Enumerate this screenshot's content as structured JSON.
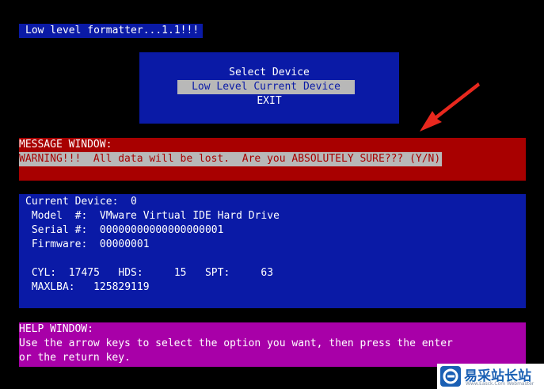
{
  "title": "Low level formatter...1.1!!!",
  "menu": {
    "items": [
      {
        "label": "Select Device"
      },
      {
        "label": "Low Level Current Device",
        "selected": true
      },
      {
        "label": "EXIT"
      }
    ]
  },
  "message_window": {
    "header": "MESSAGE WINDOW:",
    "text": "WARNING!!!  All data will be lost.  Are you ABSOLUTELY SURE??? (Y/N)"
  },
  "device_window": {
    "current_device": "Current Device:  0",
    "model": " Model  #:  VMware Virtual IDE Hard Drive",
    "serial": " Serial #:  00000000000000000001",
    "firmware": " Firmware:  00000001",
    "geometry": " CYL:  17475   HDS:     15   SPT:     63",
    "maxlba": " MAXLBA:   125829119"
  },
  "help_window": {
    "header": "HELP WINDOW:",
    "line1": "Use the arrow keys to select the option you want, then press the enter",
    "line2": "or the return key."
  },
  "watermark": {
    "title": "易采站长站",
    "subtitle": "Www.Easck.Com Webmaster"
  },
  "colors": {
    "blue": "#0a1aa6",
    "red": "#a80000",
    "magenta": "#a800a8",
    "highlight": "#b8b8b8",
    "annotation": "#e8281e"
  }
}
